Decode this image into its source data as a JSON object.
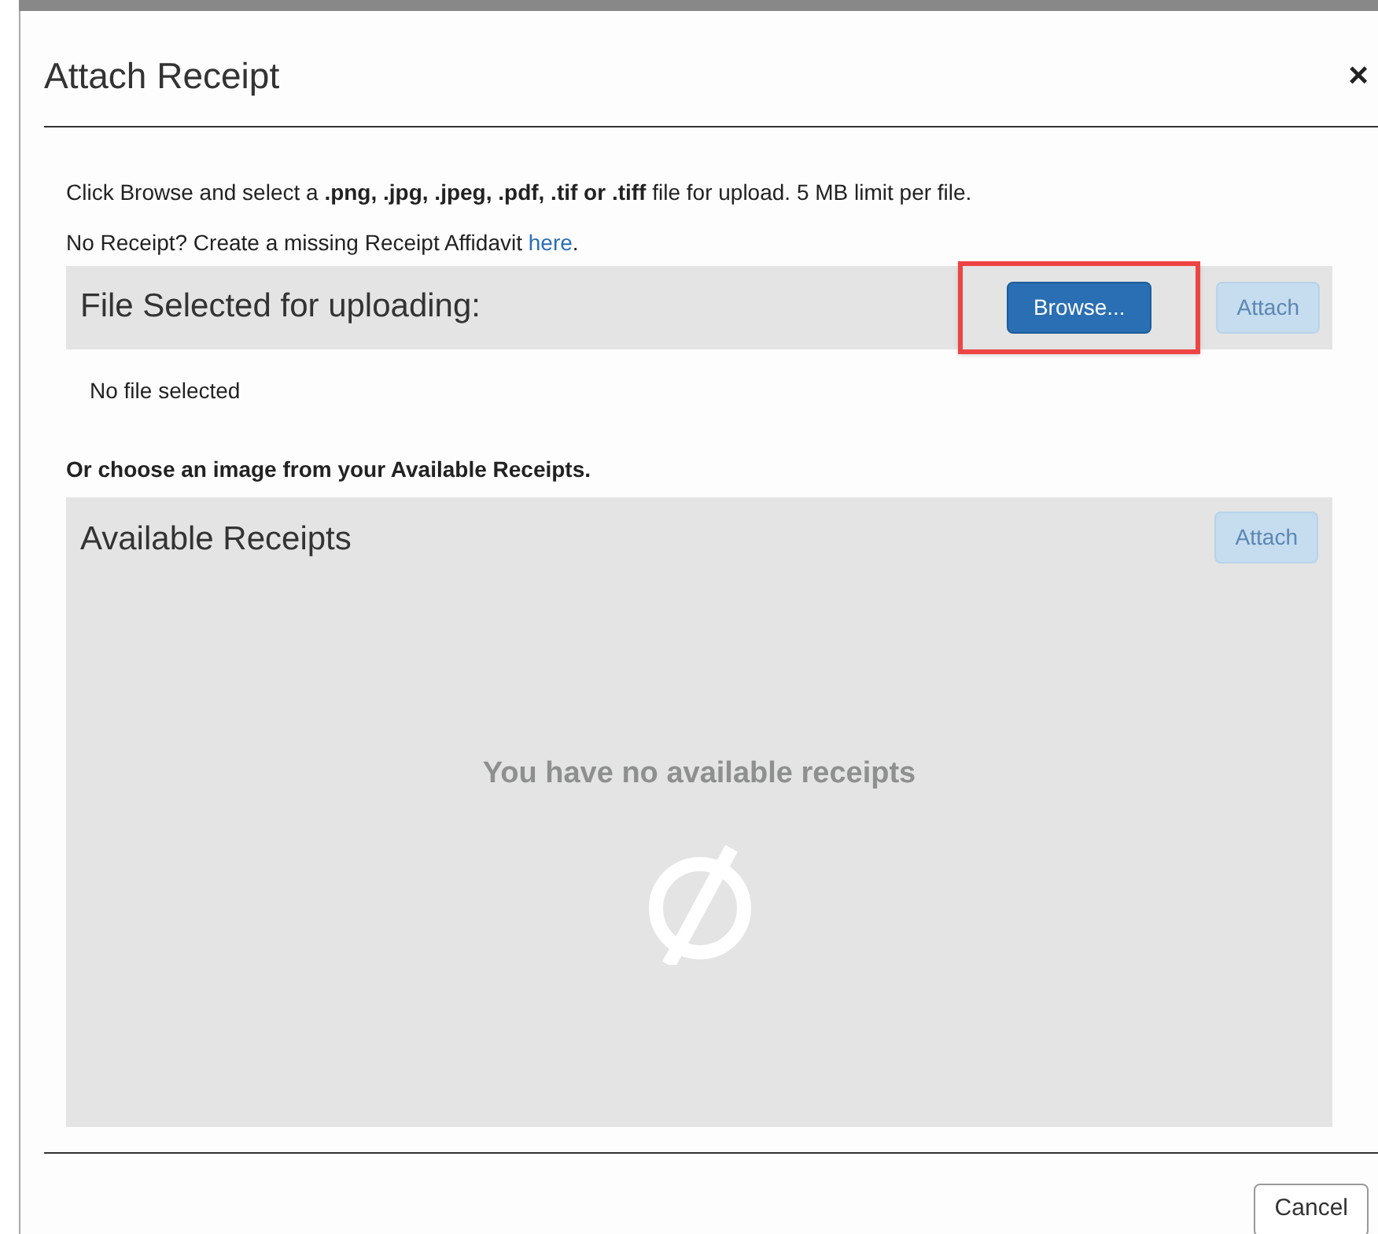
{
  "dialog": {
    "title": "Attach Receipt",
    "close": "×"
  },
  "instructions": [
    "Click Browse and select a **.png, .jpg, .jpeg, .pdf, .tif or .tiff** file for upload. 5 MB limit per file."
  ],
  "affidavit": {
    "text": "No Receipt? Create a missing Receipt Affidavit ",
    "link": "here",
    "end": "."
  },
  "upload": {
    "heading": "File Selected for uploading:",
    "buttons": [
      {
        "label": "Browse...",
        "disabled": false,
        "highlighted": true
      },
      {
        "label": "Attach",
        "disabled": true,
        "highlighted": false
      }
    ],
    "status": "No file selected"
  },
  "available_prompt": "Or choose an image from your Available Receipts.",
  "available": {
    "heading": "Available Receipts",
    "buttons": [
      {
        "label": "Attach",
        "disabled": true,
        "highlighted": false
      }
    ],
    "empty_message": "You have no available receipts"
  },
  "footer": {
    "buttons": [
      {
        "label": "Cancel",
        "disabled": false
      }
    ]
  }
}
